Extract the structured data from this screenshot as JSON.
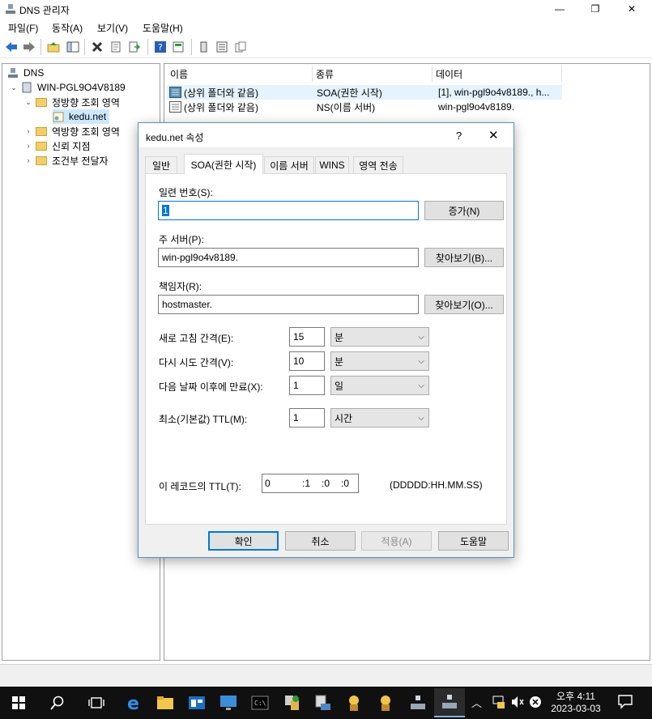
{
  "window": {
    "title": "DNS 관리자"
  },
  "menu": [
    "파일(F)",
    "동작(A)",
    "보기(V)",
    "도움말(H)"
  ],
  "tree": {
    "root": "DNS",
    "server": "WIN-PGL9O4V8189",
    "forward_zones": "정방향 조회 영역",
    "zone": "kedu.net",
    "reverse_zones": "역방향 조회 영역",
    "trust_points": "신뢰 지점",
    "conditional_forwarders": "조건부 전달자"
  },
  "list": {
    "columns": [
      "이름",
      "종류",
      "데이터"
    ],
    "rows": [
      {
        "name": "(상위 폴더와 같음)",
        "type": "SOA(권한 시작)",
        "data": "[1], win-pgl9o4v8189., h..."
      },
      {
        "name": "(상위 폴더와 같음)",
        "type": "NS(이름 서버)",
        "data": "win-pgl9o4v8189."
      }
    ]
  },
  "dialog": {
    "title": "kedu.net 속성",
    "help": "?",
    "tabs": [
      "일반",
      "SOA(권한 시작)",
      "이름 서버",
      "WINS",
      "영역 전송"
    ],
    "serial_label": "일련 번호(S):",
    "serial_value": "1",
    "increment_button": "증가(N)",
    "primary_server_label": "주 서버(P):",
    "primary_server_value": "win-pgl9o4v8189.",
    "browse_p_button": "찾아보기(B)...",
    "responsible_label": "책임자(R):",
    "responsible_value": "hostmaster.",
    "browse_o_button": "찾아보기(O)...",
    "refresh_label": "새로 고침 간격(E):",
    "refresh_value": "15",
    "refresh_unit": "분",
    "retry_label": "다시 시도 간격(V):",
    "retry_value": "10",
    "retry_unit": "분",
    "expire_label": "다음 날짜 이후에 만료(X):",
    "expire_value": "1",
    "expire_unit": "일",
    "minttl_label": "최소(기본값) TTL(M):",
    "minttl_value": "1",
    "minttl_unit": "시간",
    "record_ttl_label": "이 레코드의 TTL(T):",
    "ttl_days": "0",
    "ttl_hours": ":1",
    "ttl_minutes": ":0",
    "ttl_seconds": ":0",
    "ttl_format": "(DDDDD:HH.MM.SS)",
    "ok_button": "확인",
    "cancel_button": "취소",
    "apply_button": "적용(A)",
    "help_button": "도움말"
  },
  "taskbar": {
    "clock_time": "오후 4:11",
    "clock_date": "2023-03-03"
  }
}
